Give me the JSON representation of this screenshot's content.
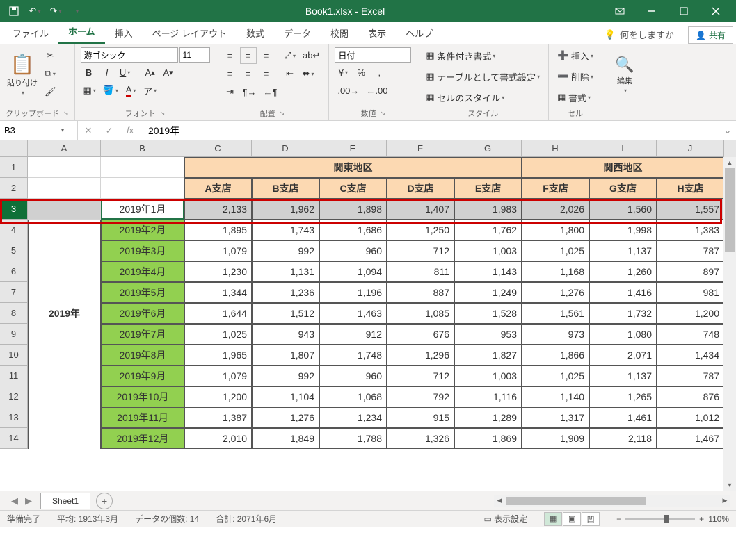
{
  "title": "Book1.xlsx - Excel",
  "tabs": {
    "file": "ファイル",
    "home": "ホーム",
    "insert": "挿入",
    "layout": "ページ レイアウト",
    "formulas": "数式",
    "data": "データ",
    "review": "校閲",
    "view": "表示",
    "help": "ヘルプ"
  },
  "tellme": "何をしますか",
  "share": "共有",
  "ribbon": {
    "clipboard": {
      "paste": "貼り付け",
      "label": "クリップボード"
    },
    "font": {
      "name": "游ゴシック",
      "size": "11",
      "label": "フォント"
    },
    "align": {
      "label": "配置"
    },
    "number": {
      "format": "日付",
      "label": "数値"
    },
    "styles": {
      "cond": "条件付き書式",
      "table": "テーブルとして書式設定",
      "cell": "セルのスタイル",
      "label": "スタイル"
    },
    "cells": {
      "insert": "挿入",
      "delete": "削除",
      "format": "書式",
      "label": "セル"
    },
    "edit": {
      "label": "編集"
    }
  },
  "namebox": "B3",
  "formula": "2019年",
  "columns": [
    "A",
    "B",
    "C",
    "D",
    "E",
    "F",
    "G",
    "H",
    "I",
    "J"
  ],
  "regions": {
    "kanto": "関東地区",
    "kansai": "関西地区"
  },
  "shops": [
    "A支店",
    "B支店",
    "C支店",
    "D支店",
    "E支店",
    "F支店",
    "G支店",
    "H支店"
  ],
  "year": "2019年",
  "months": [
    "2019年1月",
    "2019年2月",
    "2019年3月",
    "2019年4月",
    "2019年5月",
    "2019年6月",
    "2019年7月",
    "2019年8月",
    "2019年9月",
    "2019年10月",
    "2019年11月",
    "2019年12月"
  ],
  "data": [
    [
      "2,133",
      "1,962",
      "1,898",
      "1,407",
      "1,983",
      "2,026",
      "1,560",
      "1,557"
    ],
    [
      "1,895",
      "1,743",
      "1,686",
      "1,250",
      "1,762",
      "1,800",
      "1,998",
      "1,383"
    ],
    [
      "1,079",
      "992",
      "960",
      "712",
      "1,003",
      "1,025",
      "1,137",
      "787"
    ],
    [
      "1,230",
      "1,131",
      "1,094",
      "811",
      "1,143",
      "1,168",
      "1,260",
      "897"
    ],
    [
      "1,344",
      "1,236",
      "1,196",
      "887",
      "1,249",
      "1,276",
      "1,416",
      "981"
    ],
    [
      "1,644",
      "1,512",
      "1,463",
      "1,085",
      "1,528",
      "1,561",
      "1,732",
      "1,200"
    ],
    [
      "1,025",
      "943",
      "912",
      "676",
      "953",
      "973",
      "1,080",
      "748"
    ],
    [
      "1,965",
      "1,807",
      "1,748",
      "1,296",
      "1,827",
      "1,866",
      "2,071",
      "1,434"
    ],
    [
      "1,079",
      "992",
      "960",
      "712",
      "1,003",
      "1,025",
      "1,137",
      "787"
    ],
    [
      "1,200",
      "1,104",
      "1,068",
      "792",
      "1,116",
      "1,140",
      "1,265",
      "876"
    ],
    [
      "1,387",
      "1,276",
      "1,234",
      "915",
      "1,289",
      "1,317",
      "1,461",
      "1,012"
    ],
    [
      "2,010",
      "1,849",
      "1,788",
      "1,326",
      "1,869",
      "1,909",
      "2,118",
      "1,467"
    ]
  ],
  "sheet": "Sheet1",
  "status": {
    "ready": "準備完了",
    "avg": "平均: 1913年3月",
    "count": "データの個数: 14",
    "sum": "合計: 2071年6月",
    "display": "表示設定",
    "zoom": "110%"
  }
}
